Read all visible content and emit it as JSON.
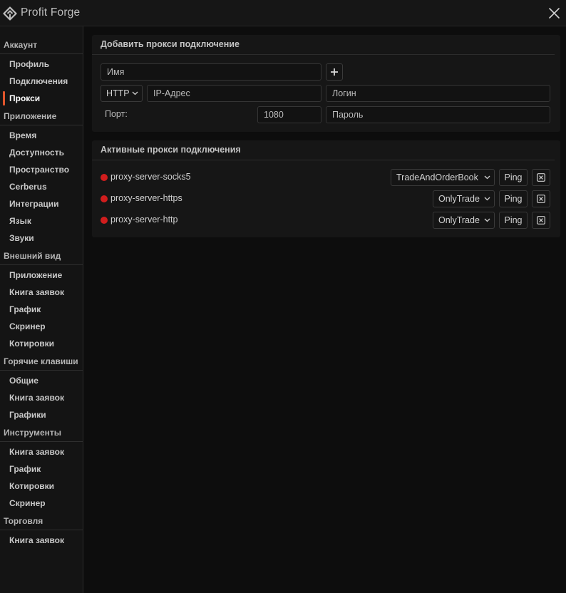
{
  "app": {
    "title": "Profit Forge",
    "icons": {
      "logo": "profit-forge-logo-icon",
      "close": "close-icon"
    }
  },
  "sidebar": {
    "sections": [
      {
        "title": "Аккаунт",
        "items": [
          "Профиль",
          "Подключения",
          "Прокси"
        ]
      },
      {
        "title": "Приложение",
        "items": [
          "Время",
          "Доступность",
          "Пространство",
          "Cerberus",
          "Интеграции",
          "Язык",
          "Звуки"
        ]
      },
      {
        "title": "Внешний вид",
        "items": [
          "Приложение",
          "Книга заявок",
          "График",
          "Скринер",
          "Котировки"
        ]
      },
      {
        "title": "Горячие клавиши",
        "items": [
          "Общие",
          "Книга заявок",
          "Графики"
        ]
      },
      {
        "title": "Инструменты",
        "items": [
          "Книга заявок",
          "График",
          "Котировки",
          "Скринер"
        ]
      },
      {
        "title": "Торговля",
        "items": [
          "Книга заявок"
        ]
      }
    ],
    "active_item": "Прокси",
    "accent_color": "#e0552c"
  },
  "add_proxy": {
    "title": "Добавить прокси подключение",
    "name_placeholder": "Имя",
    "add_button_icon": "plus-icon",
    "protocol_value": "HTTP",
    "ip_placeholder": "IP-Адрес",
    "login_placeholder": "Логин",
    "port_label": "Порт:",
    "port_value": "1080",
    "password_placeholder": "Пароль"
  },
  "active_proxies": {
    "title": "Активные прокси подключения",
    "ping_label": "Ping",
    "status_color": "#d11d1d",
    "rows": [
      {
        "name": "proxy-server-socks5",
        "mode": "TradeAndOrderBook"
      },
      {
        "name": "proxy-server-https",
        "mode": "OnlyTrade"
      },
      {
        "name": "proxy-server-http",
        "mode": "OnlyTrade"
      }
    ]
  }
}
